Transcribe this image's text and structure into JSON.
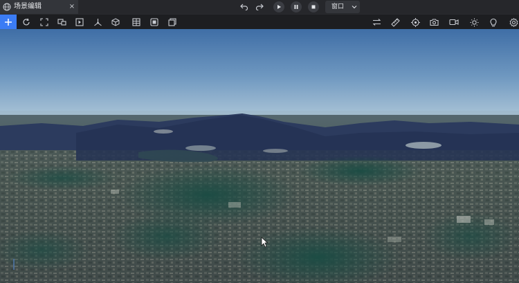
{
  "tab": {
    "title": "场景编辑",
    "close": "×",
    "icon": "globe-icon"
  },
  "header": {
    "undo_icon": "undo-icon",
    "redo_icon": "redo-icon",
    "playback": [
      "play-icon",
      "pause-icon",
      "stop-icon"
    ],
    "window_select": {
      "label": "窗口",
      "icon": "chevron-down-icon"
    }
  },
  "toolbar": {
    "add_icon": "plus-icon",
    "left_tools": [
      "refresh-icon",
      "fullscreen-icon",
      "screen-mirror-icon",
      "play-frame-icon",
      "axis-transform-icon",
      "cube-icon",
      "grid-icon",
      "layers-icon",
      "frame-icon"
    ],
    "right_tools": [
      "swap-icon",
      "ruler-icon",
      "target-icon",
      "camera-icon",
      "video-icon",
      "sun-icon",
      "bulb-icon",
      "settings-icon"
    ]
  },
  "viewport": {
    "sky_top": "#4a78ad",
    "sky_bottom": "#a6c1d6",
    "mountains": "#2a3a5c",
    "terrain_base": "#3c4a4d",
    "forest": "#1f4a44",
    "accent": "#3b7cf5"
  }
}
